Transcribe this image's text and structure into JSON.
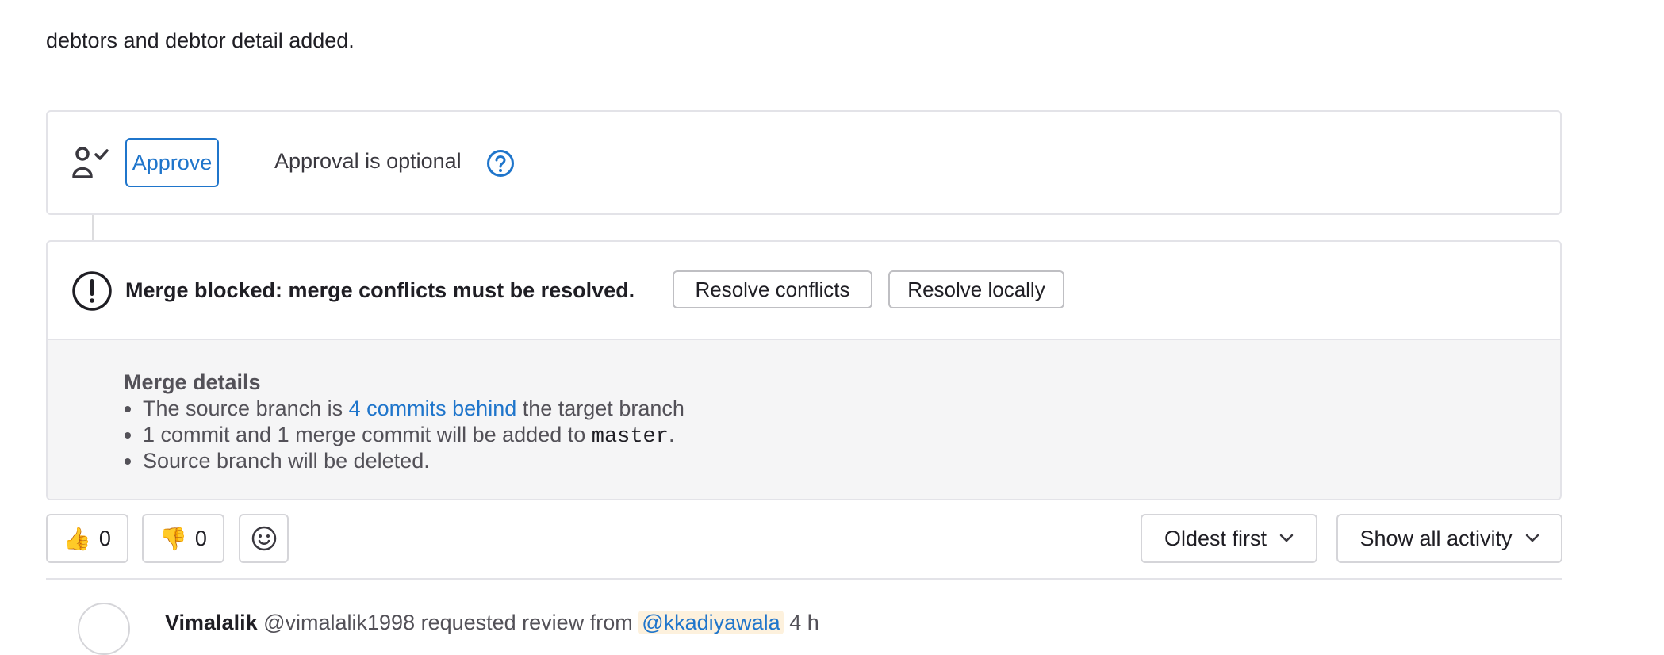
{
  "description": "debtors and debtor detail added.",
  "approval": {
    "approve_label": "Approve",
    "status_text": "Approval is optional"
  },
  "merge": {
    "title": "Merge blocked: merge conflicts must be resolved.",
    "resolve_conflicts_label": "Resolve conflicts",
    "resolve_locally_label": "Resolve locally",
    "details_title": "Merge details",
    "details": {
      "item1_prefix": "The source branch is ",
      "item1_link": "4 commits behind",
      "item1_suffix": " the target branch",
      "item2_prefix": "1 commit and 1 merge commit will be added to ",
      "item2_branch": "master",
      "item2_suffix": ".",
      "item3": "Source branch will be deleted."
    }
  },
  "reactions": {
    "thumbs_up_emoji": "👍",
    "thumbs_up_count": "0",
    "thumbs_down_emoji": "👎",
    "thumbs_down_count": "0"
  },
  "activity": {
    "sort_label": "Oldest first",
    "filter_label": "Show all activity"
  },
  "note": {
    "author": "Vimalalik",
    "text": " @vimalalik1998 requested review from ",
    "mention": "@kkadiyawala",
    "time": " 4 h"
  },
  "colors": {
    "accent": "#1f75cb",
    "border": "#e3e3e8",
    "body_bg": "#f5f5f6"
  },
  "icons": [
    "approver-icon",
    "help-icon",
    "alert-icon",
    "smiley-icon",
    "chevron-down-icon"
  ]
}
